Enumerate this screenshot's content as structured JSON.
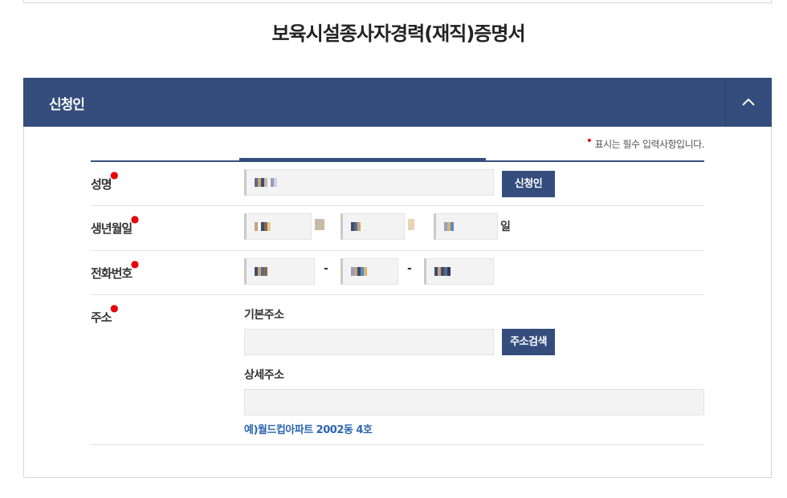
{
  "page": {
    "title": "보육시설종사자경력(재직)증명서"
  },
  "panel": {
    "title": "신청인",
    "collapse_icon": "chevron-up-icon"
  },
  "required_note": {
    "marker": "•",
    "text": "표시는 필수 입력사항입니다."
  },
  "fields": {
    "name": {
      "label": "성명",
      "value_masked": true,
      "button_label": "신청인"
    },
    "birth": {
      "label": "생년월일",
      "year_unit": "년",
      "month_unit": "월",
      "day_unit": "일"
    },
    "phone": {
      "label": "전화번호",
      "separator": "-"
    },
    "address": {
      "label": "주소",
      "basic_label": "기본주소",
      "search_button": "주소검색",
      "detail_label": "상세주소",
      "example": "예)월드컵아파트 2002동 4호"
    }
  },
  "colors": {
    "primary": "#344d7c",
    "required": "#e8000b",
    "link": "#2b66b1",
    "input_bg": "#f3f3f3"
  }
}
